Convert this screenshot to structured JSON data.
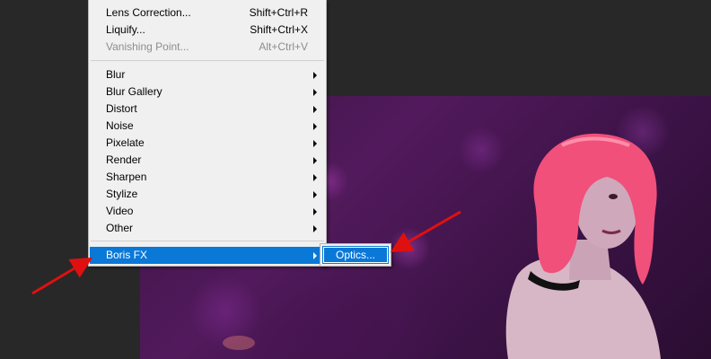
{
  "filter_menu": {
    "items": [
      {
        "label": "Lens Correction...",
        "shortcut": "Shift+Ctrl+R",
        "enabled": true
      },
      {
        "label": "Liquify...",
        "shortcut": "Shift+Ctrl+X",
        "enabled": true
      },
      {
        "label": "Vanishing Point...",
        "shortcut": "Alt+Ctrl+V",
        "enabled": false
      }
    ],
    "submenus": [
      {
        "label": "Blur"
      },
      {
        "label": "Blur Gallery"
      },
      {
        "label": "Distort"
      },
      {
        "label": "Noise"
      },
      {
        "label": "Pixelate"
      },
      {
        "label": "Render"
      },
      {
        "label": "Sharpen"
      },
      {
        "label": "Stylize"
      },
      {
        "label": "Video"
      },
      {
        "label": "Other"
      }
    ],
    "plugin": {
      "label": "Boris FX",
      "highlighted": true
    }
  },
  "boris_fx_submenu": {
    "items": [
      {
        "label": "Optics...",
        "highlighted": true
      }
    ]
  },
  "colors": {
    "workspace": "#282828",
    "menu_bg": "#f0f0f0",
    "highlight": "#0a78d7",
    "annotation_arrow": "#e01010",
    "wig": "#f0507a"
  },
  "canvas": {
    "image": "woman-with-pink-wig-photo"
  }
}
